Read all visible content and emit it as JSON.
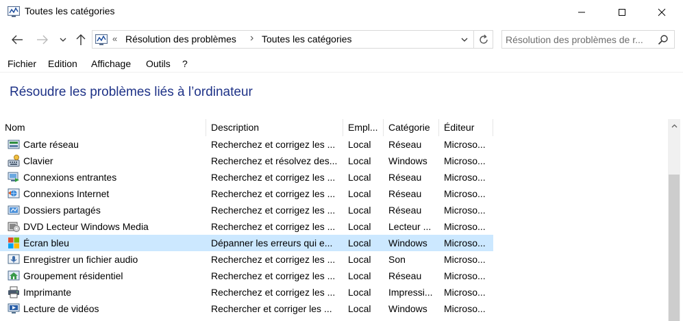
{
  "window": {
    "title": "Toutes les catégories",
    "icon": "troubleshooting-icon"
  },
  "address": {
    "separator": "«",
    "crumbs": [
      "Résolution des problèmes",
      "Toutes les catégories"
    ],
    "crumb_separator": "›"
  },
  "search": {
    "placeholder": "Résolution des problèmes de r..."
  },
  "menu": {
    "items": [
      "Fichier",
      "Edition",
      "Affichage",
      "Outils",
      "?"
    ]
  },
  "heading": "Résoudre les problèmes liés à l’ordinateur",
  "table": {
    "columns": [
      "Nom",
      "Description",
      "Empl...",
      "Catégorie",
      "Éditeur"
    ],
    "rows": [
      {
        "name": "Carte réseau",
        "description": "Recherchez et corrigez les ...",
        "location": "Local",
        "category": "Réseau",
        "publisher": "Microso...",
        "icon": "network-adapter-icon"
      },
      {
        "name": "Clavier",
        "description": "Recherchez et résolvez des...",
        "location": "Local",
        "category": "Windows",
        "publisher": "Microso...",
        "icon": "keyboard-icon"
      },
      {
        "name": "Connexions entrantes",
        "description": "Recherchez et corrigez les ...",
        "location": "Local",
        "category": "Réseau",
        "publisher": "Microso...",
        "icon": "incoming-connections-icon"
      },
      {
        "name": "Connexions Internet",
        "description": "Recherchez et corrigez les ...",
        "location": "Local",
        "category": "Réseau",
        "publisher": "Microso...",
        "icon": "internet-connections-icon"
      },
      {
        "name": "Dossiers partagés",
        "description": "Recherchez et corrigez les ...",
        "location": "Local",
        "category": "Réseau",
        "publisher": "Microso...",
        "icon": "shared-folders-icon"
      },
      {
        "name": "DVD Lecteur Windows Media",
        "description": "Recherchez et corrigez les ...",
        "location": "Local",
        "category": "Lecteur ...",
        "publisher": "Microso...",
        "icon": "dvd-icon"
      },
      {
        "name": "Écran bleu",
        "description": "Dépanner les erreurs qui e...",
        "location": "Local",
        "category": "Windows",
        "publisher": "Microso...",
        "icon": "windows-logo-icon",
        "selected": true
      },
      {
        "name": "Enregistrer un fichier audio",
        "description": "Recherchez et corrigez les ...",
        "location": "Local",
        "category": "Son",
        "publisher": "Microso...",
        "icon": "audio-record-icon"
      },
      {
        "name": "Groupement résidentiel",
        "description": "Recherchez et corrigez les ...",
        "location": "Local",
        "category": "Réseau",
        "publisher": "Microso...",
        "icon": "homegroup-icon"
      },
      {
        "name": "Imprimante",
        "description": "Recherchez et corrigez les ...",
        "location": "Local",
        "category": "Impressi...",
        "publisher": "Microso...",
        "icon": "printer-icon"
      },
      {
        "name": "Lecture de vidéos",
        "description": "Rechercher et corriger les ...",
        "location": "Local",
        "category": "Windows",
        "publisher": "Microso...",
        "icon": "video-playback-icon"
      }
    ]
  },
  "colors": {
    "heading": "#1e3287",
    "selected_row": "#cce8ff"
  }
}
